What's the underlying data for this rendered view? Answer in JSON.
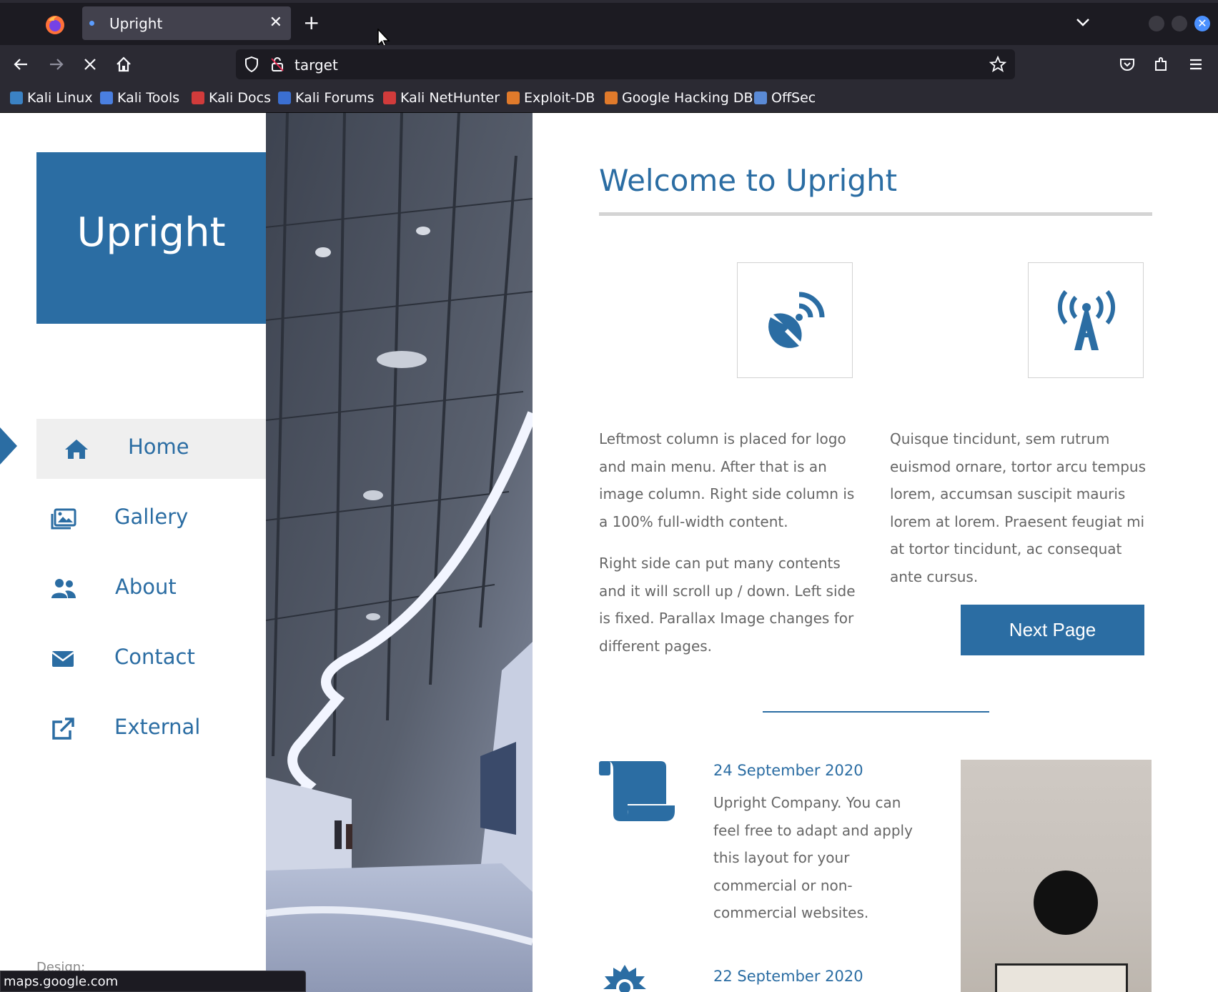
{
  "browser": {
    "tab_title": "Upright",
    "url": "target",
    "status_url": "maps.google.com",
    "bookmarks": [
      {
        "label": "Kali Linux",
        "color": "#3b82c4"
      },
      {
        "label": "Kali Tools",
        "color": "#4a7fe0"
      },
      {
        "label": "Kali Docs",
        "color": "#d13b3b"
      },
      {
        "label": "Kali Forums",
        "color": "#3b6fd1"
      },
      {
        "label": "Kali NetHunter",
        "color": "#d13b3b"
      },
      {
        "label": "Exploit-DB",
        "color": "#e07a2b"
      },
      {
        "label": "Google Hacking DB",
        "color": "#e07a2b"
      },
      {
        "label": "OffSec",
        "color": "#5a8ad6"
      }
    ]
  },
  "site": {
    "logo": "Upright",
    "accent": "#2b6da3",
    "menu": [
      {
        "label": "Home",
        "icon": "home-icon",
        "active": true
      },
      {
        "label": "Gallery",
        "icon": "gallery-icon",
        "active": false
      },
      {
        "label": "About",
        "icon": "users-icon",
        "active": false
      },
      {
        "label": "Contact",
        "icon": "envelope-icon",
        "active": false
      },
      {
        "label": "External",
        "icon": "external-link-icon",
        "active": false
      }
    ],
    "design_label": "Design:"
  },
  "main": {
    "heading": "Welcome to Upright",
    "feature_icons": [
      "satellite-dish-icon",
      "broadcast-tower-icon"
    ],
    "col1_p1": "Leftmost column is placed for logo and main menu. After that is an image column. Right side column is a 100% full-width content.",
    "col1_p2": "Right side can put many contents and it will scroll up / down. Left side is fixed. Parallax Image changes for different pages.",
    "col2_p1": "Quisque tincidunt, sem rutrum euismod ornare, tortor arcu tempus lorem, accumsan suscipit mauris lorem at lorem. Praesent feugiat mi at tortor tincidunt, ac consequat ante cursus.",
    "next_button": "Next Page",
    "news": [
      {
        "date": "24 September 2020",
        "text": "Upright Company. You can feel free to adapt and apply this layout for your commercial or non-commercial websites.",
        "icon": "scroll-icon"
      },
      {
        "date": "22 September 2020",
        "text": "",
        "icon": "sun-cloud-icon"
      }
    ]
  }
}
